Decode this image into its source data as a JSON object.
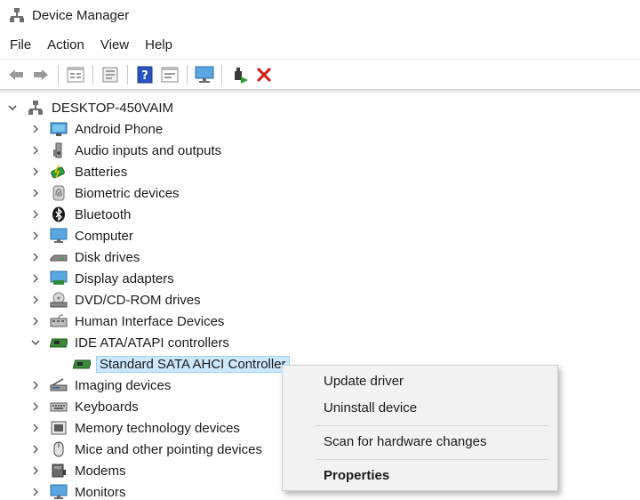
{
  "window": {
    "title": "Device Manager",
    "icon": "device-manager-icon"
  },
  "menu": [
    "File",
    "Action",
    "View",
    "Help"
  ],
  "toolbar": [
    "back-arrow-icon",
    "forward-arrow-icon",
    "properties-grid-icon",
    "update-driver-icon",
    "help-icon",
    "show-hidden-icon",
    "monitor-icon",
    "add-driver-icon",
    "remove-red-x-icon"
  ],
  "tree": {
    "root": "DESKTOP-450VAIM",
    "categories": [
      "Android Phone",
      "Audio inputs and outputs",
      "Batteries",
      "Biometric devices",
      "Bluetooth",
      "Computer",
      "Disk drives",
      "Display adapters",
      "DVD/CD-ROM drives",
      "Human Interface Devices",
      "IDE ATA/ATAPI controllers",
      "Imaging devices",
      "Keyboards",
      "Memory technology devices",
      "Mice and other pointing devices",
      "Modems",
      "Monitors"
    ],
    "expanded_child": "Standard SATA AHCI Controller"
  },
  "context_menu": {
    "items": [
      "Update driver",
      "Uninstall device",
      "Scan for hardware changes",
      "Properties"
    ]
  },
  "colors": {
    "selection": "#cce8ff",
    "remove": "#d0241c",
    "menu_bg": "#f2f2f2"
  }
}
